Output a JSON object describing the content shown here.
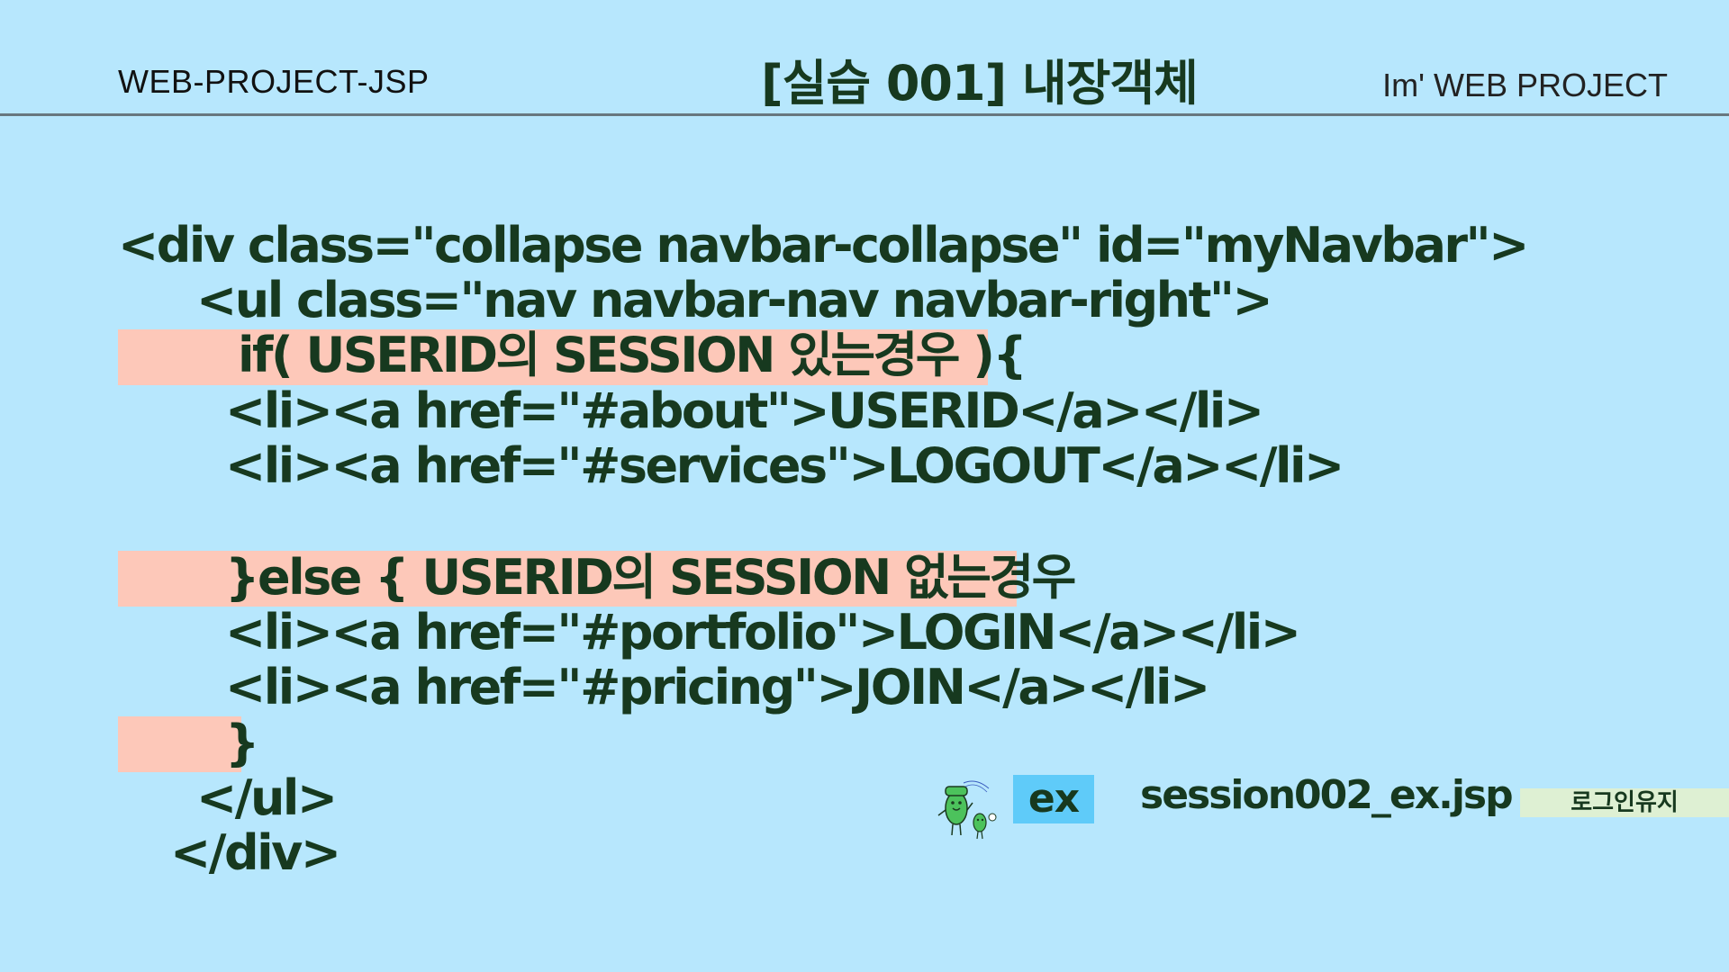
{
  "header": {
    "left": "WEB-PROJECT-JSP",
    "title": "[실습 001] 내장객체",
    "right": "Im' WEB PROJECT"
  },
  "code_lines": [
    "<div class=\"collapse navbar-collapse\" id=\"myNavbar\">",
    "<ul class=\"nav navbar-nav navbar-right\">",
    "if( USERID의 SESSION 있는경우 ){",
    "<li><a href=\"#about\">USERID</a></li>",
    "<li><a href=\"#services\">LOGOUT</a></li>",
    "}else { USERID의 SESSION 없는경우",
    "<li><a href=\"#portfolio\">LOGIN</a></li>",
    "<li><a href=\"#pricing\">JOIN</a></li>",
    "}",
    "</ul>",
    "</div>"
  ],
  "footer": {
    "mascot_icon": "mascot-characters-icon",
    "badge": "ex",
    "filename": "session002_ex.jsp",
    "tag": "로그인유지"
  },
  "colors": {
    "background": "#b7e7fd",
    "text": "#17391f",
    "highlight": "#fdc8b9",
    "badge": "#5fcbf9",
    "tag": "#def0d3"
  }
}
